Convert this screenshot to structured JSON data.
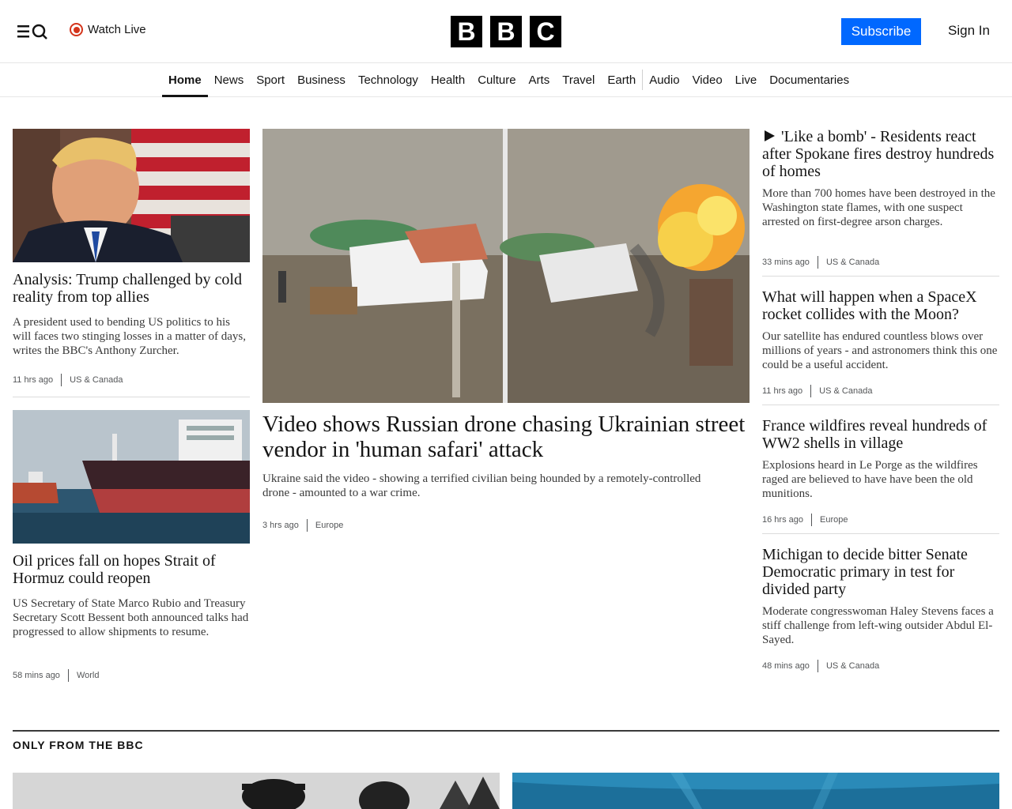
{
  "header": {
    "watch_live": "Watch Live",
    "logo_letters": [
      "B",
      "B",
      "C"
    ],
    "subscribe": "Subscribe",
    "sign_in": "Sign In",
    "accent": "#0068ff",
    "live_color": "#d4351c"
  },
  "nav": {
    "items": [
      "Home",
      "News",
      "Sport",
      "Business",
      "Technology",
      "Health",
      "Culture",
      "Arts",
      "Travel",
      "Earth",
      "Audio",
      "Video",
      "Live",
      "Documentaries"
    ],
    "active": "Home"
  },
  "left": {
    "story1": {
      "headline": "Analysis: Trump challenged by cold reality from top allies",
      "summary": "A president used to bending US politics to his will faces two stinging losses in a matter of days, writes the BBC's Anthony Zurcher.",
      "time": "11 hrs ago",
      "section": "US & Canada"
    },
    "story2": {
      "headline": "Oil prices fall on hopes Strait of Hormuz could reopen",
      "summary": "US Secretary of State Marco Rubio and Treasury Secretary Scott Bessent both announced talks had progressed to allow shipments to resume.",
      "time": "58 mins ago",
      "section": "World"
    }
  },
  "center": {
    "headline": "Video shows Russian drone chasing Ukrainian street vendor in 'human safari' attack",
    "summary": "Ukraine said the video - showing a terrified civilian being hounded by a remotely-controlled drone - amounted to a war crime.",
    "time": "3 hrs ago",
    "section": "Europe"
  },
  "right": {
    "story1": {
      "headline": "'Like a bomb' - Residents react after Spokane fires destroy hundreds of homes",
      "summary": "More than 700 homes have been destroyed in the Washington state flames, with one suspect arrested on first-degree arson charges.",
      "time": "33 mins ago",
      "section": "US & Canada",
      "icon": "play-icon"
    },
    "story2": {
      "headline": "What will happen when a SpaceX rocket collides with the Moon?",
      "summary": "Our satellite has endured countless blows over millions of years - and astronomers think this one could be a useful accident.",
      "time": "11 hrs ago",
      "section": "US & Canada"
    },
    "story3": {
      "headline": "France wildfires reveal hundreds of WW2 shells in village",
      "summary": "Explosions heard in Le Porge as the wildfires raged are believed to have have been the old munitions.",
      "time": "16 hrs ago",
      "section": "Europe"
    },
    "story4": {
      "headline": "Michigan to decide bitter Senate Democratic primary in test for divided party",
      "summary": "Moderate congresswoman Haley Stevens faces a stiff challenge from left-wing outsider Abdul El-Sayed.",
      "time": "48 mins ago",
      "section": "US & Canada"
    }
  },
  "only_from_bbc": {
    "title": "ONLY FROM THE BBC"
  }
}
